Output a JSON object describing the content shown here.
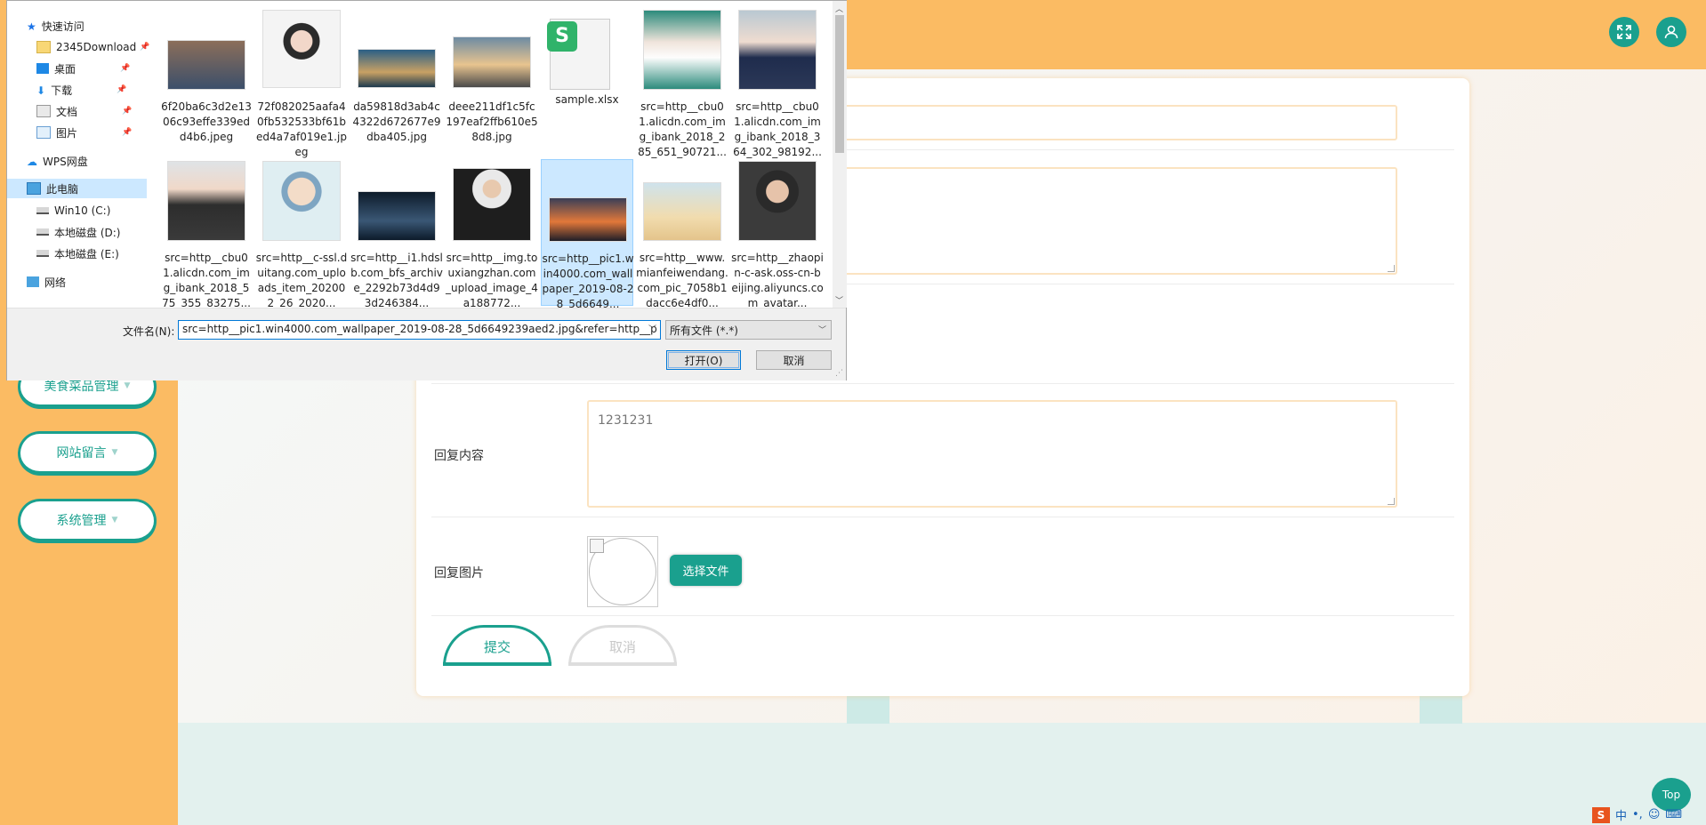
{
  "sidebar": {
    "items": [
      {
        "label": "美食菜品管理"
      },
      {
        "label": "网站留言"
      },
      {
        "label": "系统管理"
      }
    ]
  },
  "topbar": {
    "fullscreen_icon": "expand-icon",
    "user_icon": "user-icon"
  },
  "form": {
    "reply_label": "回复内容",
    "reply_value": "1231231",
    "image_label": "回复图片",
    "choose_file": "选择文件",
    "submit": "提交",
    "cancel": "取消"
  },
  "top_button": "Top",
  "tray": {
    "ime": "中",
    "punct": "•,",
    "sogou": "S"
  },
  "dialog": {
    "nav": [
      {
        "label": "快速访问",
        "icon": "star-icon"
      },
      {
        "label": "2345Download",
        "icon": "folder-icon"
      },
      {
        "label": "桌面",
        "icon": "desktop-icon"
      },
      {
        "label": "下载",
        "icon": "download-icon"
      },
      {
        "label": "文档",
        "icon": "document-icon"
      },
      {
        "label": "图片",
        "icon": "picture-icon"
      },
      {
        "label": "WPS网盘",
        "icon": "cloud-icon"
      },
      {
        "label": "此电脑",
        "icon": "computer-icon"
      },
      {
        "label": "Win10 (C:)",
        "icon": "drive-icon"
      },
      {
        "label": "本地磁盘 (D:)",
        "icon": "drive-icon"
      },
      {
        "label": "本地磁盘 (E:)",
        "icon": "drive-icon"
      },
      {
        "label": "网络",
        "icon": "network-icon"
      }
    ],
    "files": [
      {
        "name": "6f20ba6c3d2e1306c93effe339edd4b6.jpeg"
      },
      {
        "name": "72f082025aafa40fb532533bf61bed4a7af019e1.jpeg"
      },
      {
        "name": "da59818d3ab4c4322d672677e9dba405.jpg"
      },
      {
        "name": "deee211df1c5fc197eaf2ffb610e58d8.jpg"
      },
      {
        "name": "sample.xlsx"
      },
      {
        "name": "src=http__cbu01.alicdn.com_img_ibank_2018_285_651_90721..."
      },
      {
        "name": "src=http__cbu01.alicdn.com_img_ibank_2018_364_302_98192..."
      },
      {
        "name": "src=http__cbu01.alicdn.com_img_ibank_2018_575_355_83275..."
      },
      {
        "name": "src=http__c-ssl.duitang.com_uploads_item_202002_26_2020..."
      },
      {
        "name": "src=http__i1.hdslb.com_bfs_archive_2292b73d4d93d246384..."
      },
      {
        "name": "src=http__img.touxiangzhan.com_upload_image_4a188772..."
      },
      {
        "name": "src=http__pic1.win4000.com_wallpaper_2019-08-28_5d6649..."
      },
      {
        "name": "src=http__www.mianfeiwendang.com_pic_7058b1dacc6e4df0..."
      },
      {
        "name": "src=http__zhaopin-c-ask.oss-cn-beijing.aliyuncs.com_avatar..."
      }
    ],
    "filename_label": "文件名(N):",
    "filename_value": "src=http__pic1.win4000.com_wallpaper_2019-08-28_5d6649239aed2.jpg&refer=http__p",
    "filter_value": "所有文件 (*.*)",
    "open_button": "打开(O)",
    "cancel_button": "取消"
  },
  "colors": {
    "accent": "#1aa08e",
    "orange": "#fbbb63"
  }
}
